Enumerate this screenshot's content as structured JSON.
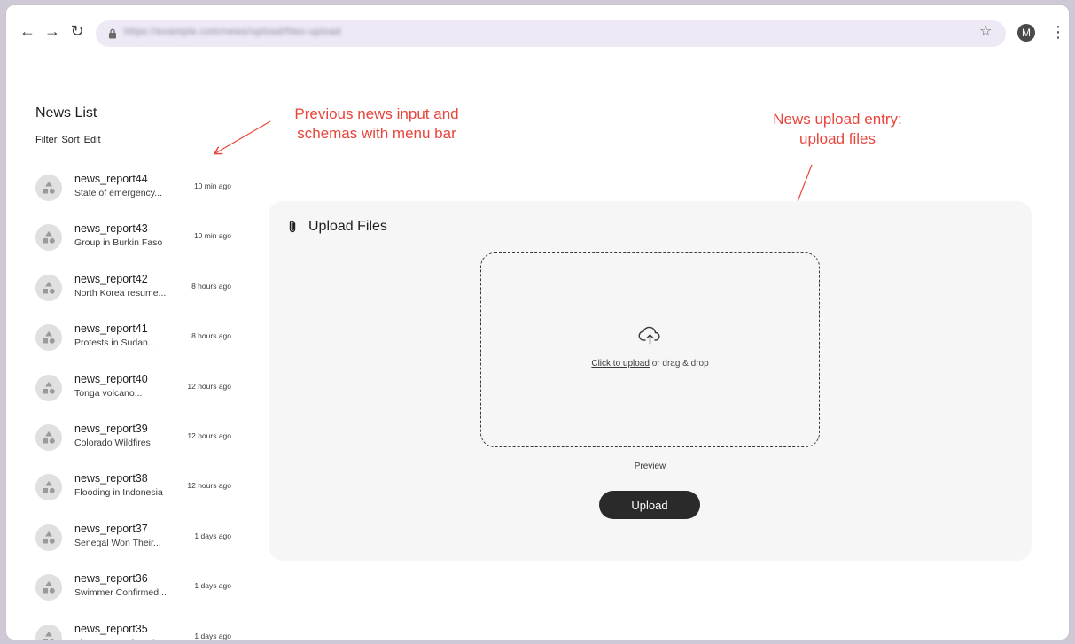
{
  "browser": {
    "url": "https://example.com/news/upload/files-upload",
    "avatar_initial": "M"
  },
  "sidebar": {
    "title": "News List",
    "menu": [
      "Filter",
      "Sort",
      "Edit"
    ],
    "items": [
      {
        "title": "news_report44",
        "subtitle": "State of emergency...",
        "time": "10 min ago"
      },
      {
        "title": "news_report43",
        "subtitle": "Group in Burkin Faso",
        "time": "10 min ago"
      },
      {
        "title": "news_report42",
        "subtitle": "North Korea resume...",
        "time": "8 hours ago"
      },
      {
        "title": "news_report41",
        "subtitle": "Protests in Sudan...",
        "time": "8 hours ago"
      },
      {
        "title": "news_report40",
        "subtitle": "Tonga volcano...",
        "time": "12 hours ago"
      },
      {
        "title": "news_report39",
        "subtitle": "Colorado Wildfires",
        "time": "12 hours ago"
      },
      {
        "title": "news_report38",
        "subtitle": "Flooding in Indonesia",
        "time": "12 hours ago"
      },
      {
        "title": "news_report37",
        "subtitle": "Senegal Won Their...",
        "time": "1 days ago"
      },
      {
        "title": "news_report36",
        "subtitle": "Swimmer Confirmed...",
        "time": "1 days ago"
      },
      {
        "title": "news_report35",
        "subtitle": "The Queen Of Englan...",
        "time": "1 days ago"
      }
    ]
  },
  "annotations": {
    "left_line1": "Previous news input and",
    "left_line2": "schemas with menu bar",
    "right_line1": "News upload entry:",
    "right_line2": "upload files",
    "color": "#e8453c"
  },
  "upload": {
    "title": "Upload Files",
    "click_link": "Click to upload",
    "drag_text": " or drag & drop",
    "preview_label": "Preview",
    "button_label": "Upload"
  }
}
